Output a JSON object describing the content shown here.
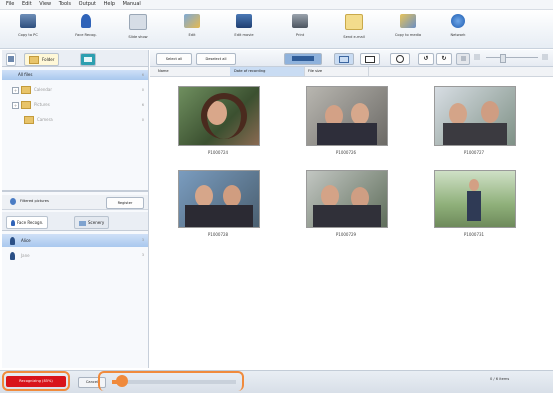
{
  "menu": [
    "File",
    "Edit",
    "View",
    "Tools",
    "Output",
    "Help",
    "Manual"
  ],
  "toolbar": [
    "Copy to PC",
    "Face Recog.",
    "Slide show",
    "Edit",
    "Edit movie",
    "Print",
    "Send e-mail",
    "Copy to media",
    "Network"
  ],
  "left_top": {
    "tabs": [
      "Folder"
    ],
    "tree": [
      {
        "label": "All files",
        "count": "6",
        "selected": true
      },
      {
        "label": "Calendar",
        "count": "0",
        "selected": false,
        "expand": true
      },
      {
        "label": "Pictures",
        "count": "6",
        "selected": false,
        "expand": true
      },
      {
        "label": "Camera",
        "count": "0",
        "selected": false
      }
    ]
  },
  "left_bottom": {
    "filter_label": "Filtered pictures",
    "filter_button": "Register",
    "tabs": [
      "Face Recogn.",
      "Scenery"
    ],
    "people": [
      {
        "name": "Alice",
        "count": "3",
        "selected": true
      },
      {
        "name": "Jane",
        "count": "3",
        "selected": false
      }
    ]
  },
  "right_toolbar": {
    "select_all": "Select all",
    "deselect_all": "Deselect all"
  },
  "columns": [
    "Name",
    "Date of recording",
    "File size"
  ],
  "thumbnails": [
    {
      "name": "P1000724"
    },
    {
      "name": "P1000726"
    },
    {
      "name": "P1000727"
    },
    {
      "name": "P1000728"
    },
    {
      "name": "P1000729"
    },
    {
      "name": "P1000731"
    }
  ],
  "status": {
    "recognizing": "Recognizing (85%)",
    "cancel": "Cancel",
    "progress": 0.12,
    "right_text": "0 / 6 items"
  },
  "colors": {
    "highlight": "#f08a3c",
    "selection": "#a9c8ee",
    "progress_red": "#d8141b"
  }
}
